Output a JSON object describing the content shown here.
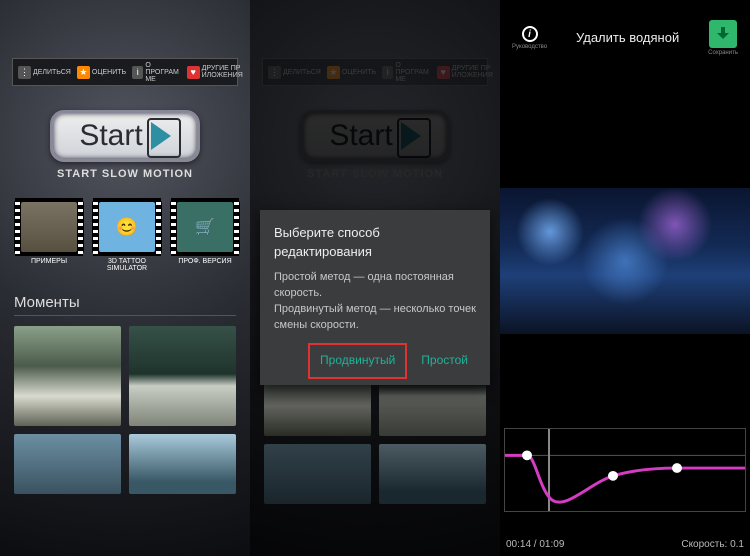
{
  "toolbar": {
    "share": "ДЕЛИТЬСЯ",
    "rate": "ОЦЕНИТЬ",
    "about": "О ПРОГРАМ\nМЕ",
    "other": "ДРУГИЕ ПР\nИЛОЖЕНИЯ"
  },
  "start": {
    "label": "Start",
    "subtitle": "START SLOW MOTION"
  },
  "thumbs": {
    "examples": "ПРИМЕРЫ",
    "tattoo": "3D TATTOO SIMULATOR",
    "pro": "ПРОФ. ВЕРСИЯ"
  },
  "section": {
    "moments": "Моменты"
  },
  "dialog": {
    "title": "Выберите способ редактирования",
    "line1": "Простой метод — одна постоянная скорость.",
    "line2": "Продвинутый метод — несколько точек смены скорости.",
    "advanced": "Продвинутый",
    "simple": "Простой"
  },
  "editor": {
    "info_label": "Руководство",
    "title": "Удалить водяной",
    "save_label": "Сохранить",
    "time": "00:14 / 01:09",
    "speed": "Скорость: 0.1"
  }
}
